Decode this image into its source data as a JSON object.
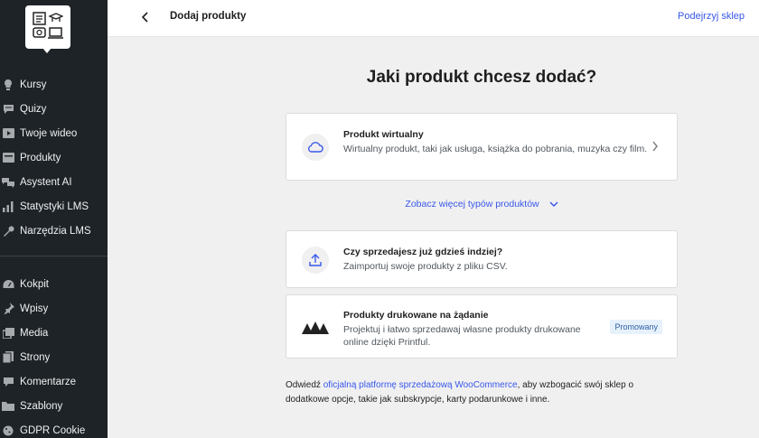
{
  "sidebar": {
    "menu_a": [
      {
        "label": "Kursy",
        "icon": "lightbulb-icon"
      },
      {
        "label": "Quizy",
        "icon": "chat-icon"
      },
      {
        "label": "Twoje wideo",
        "icon": "video-play-icon"
      },
      {
        "label": "Produkty",
        "icon": "products-icon"
      },
      {
        "label": "Asystent AI",
        "icon": "ai-chat-icon"
      },
      {
        "label": "Statystyki LMS",
        "icon": "bar-chart-icon"
      },
      {
        "label": "Narzędzia LMS",
        "icon": "wrench-icon"
      }
    ],
    "menu_b": [
      {
        "label": "Kokpit",
        "icon": "dashboard-icon"
      },
      {
        "label": "Wpisy",
        "icon": "pin-icon"
      },
      {
        "label": "Media",
        "icon": "media-icon"
      },
      {
        "label": "Strony",
        "icon": "pages-icon"
      },
      {
        "label": "Komentarze",
        "icon": "comment-icon"
      },
      {
        "label": "Szablony",
        "icon": "folder-icon"
      },
      {
        "label": "GDPR Cookie",
        "icon": "cookie-icon"
      }
    ]
  },
  "header": {
    "title": "Dodaj produkty",
    "preview_link": "Podejrzyj sklep"
  },
  "main": {
    "heading": "Jaki produkt chcesz dodać?",
    "cards": [
      {
        "title": "Produkt wirtualny",
        "desc": "Wirtualny produkt, taki jak usługa, książka do pobrania, muzyka czy film.",
        "icon": "cloud-icon"
      },
      {
        "title": "Czy sprzedajesz już gdzieś indziej?",
        "desc": "Zaimportuj swoje produkty z pliku CSV.",
        "icon": "upload-icon"
      },
      {
        "title": "Produkty drukowane na żądanie",
        "desc": "Projektuj i łatwo sprzedawaj własne produkty drukowane online dzięki Printful.",
        "icon": "printful-logo-icon",
        "badge": "Promowany"
      }
    ],
    "more_types": "Zobacz więcej typów produktów",
    "footer_before": "Odwiedź ",
    "footer_link": "oficjalną platformę sprzedażową WooCommerce",
    "footer_after": ", aby wzbogacić swój sklep o dodatkowe opcje, takie jak subskrypcje, karty podarunkowe i inne."
  }
}
